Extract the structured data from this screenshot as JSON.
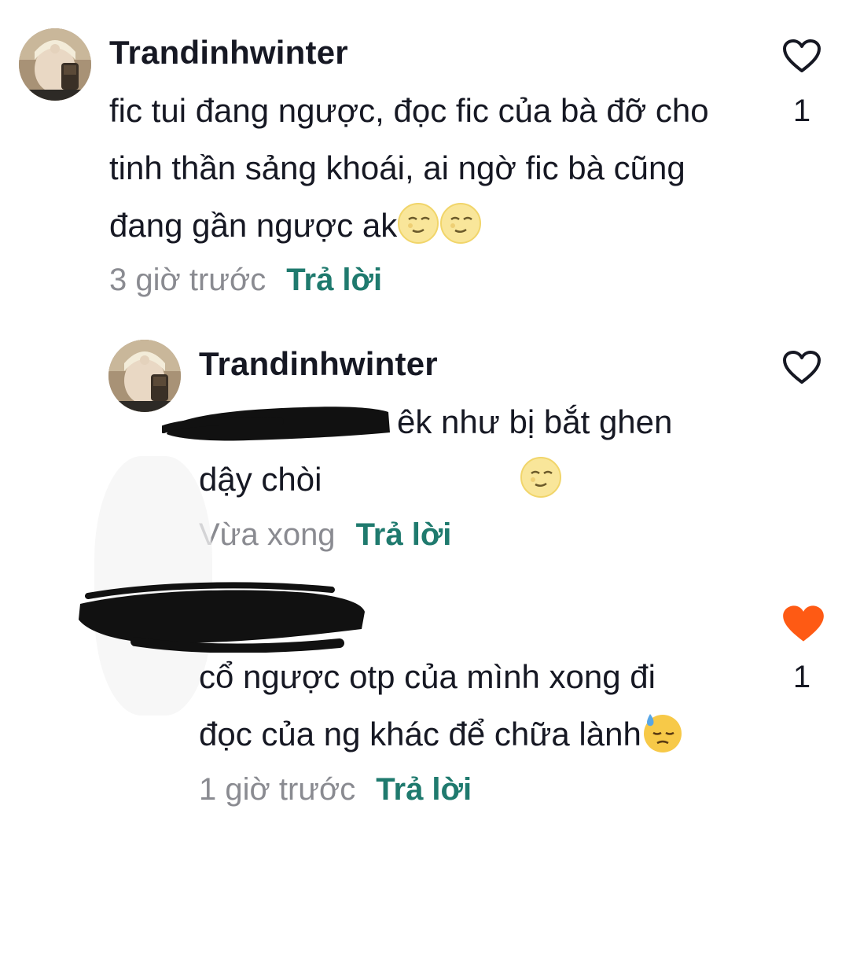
{
  "comments": [
    {
      "username": "Trandinhwinter",
      "text": "fic tui đang ngược, đọc fic của bà đỡ cho tinh thần sảng khoái, ai ngờ fic bà cũng đang gần ngược ak",
      "emojis": [
        "moon-face-icon",
        "moon-face-icon"
      ],
      "time": "3 giờ trước",
      "reply_label": "Trả lời",
      "like_count": "1",
      "liked": false
    },
    {
      "username": "Trandinhwinter",
      "text": "êk như bị bắt ghen dậy chòi",
      "emojis": [
        "moon-face-icon"
      ],
      "time": "Vừa xong",
      "reply_label": "Trả lời",
      "like_count": "",
      "liked": false
    },
    {
      "username": "",
      "text": "cổ ngược otp của mình xong đi đọc của ng khác để chữa lành",
      "emojis": [
        "downcast-sweat-face-icon"
      ],
      "time": "1 giờ trước",
      "reply_label": "Trả lời",
      "like_count": "1",
      "liked": true
    }
  ],
  "colors": {
    "reply": "#1f7a6e",
    "time": "#8a8b91",
    "liked_heart": "#fe5a14",
    "text": "#161823"
  }
}
